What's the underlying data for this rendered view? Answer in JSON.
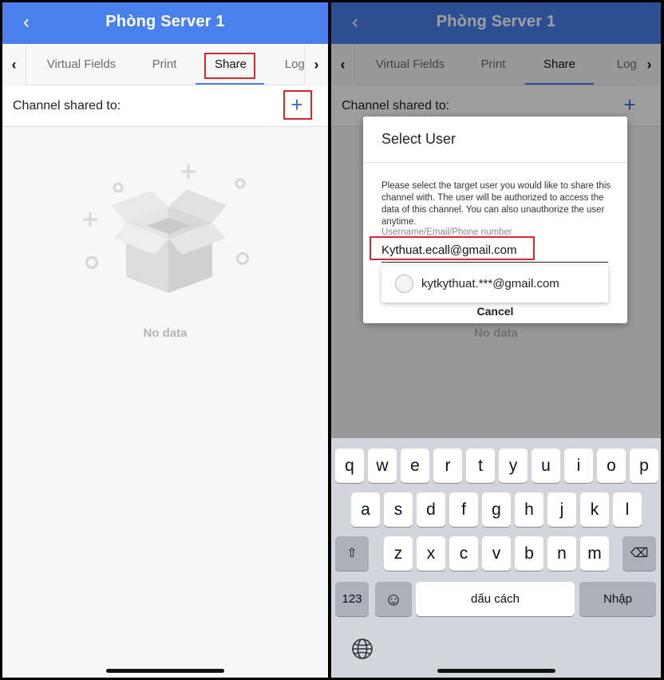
{
  "left": {
    "appbar": {
      "title": "Phòng Server 1",
      "back_glyph": "‹"
    },
    "tabs": [
      {
        "label": "Virtual Fields",
        "active": false
      },
      {
        "label": "Print",
        "active": false
      },
      {
        "label": "Share",
        "active": true
      },
      {
        "label": "Logs",
        "active": false
      }
    ],
    "channel_row": {
      "label": "Channel shared to:",
      "add_glyph": "+"
    },
    "empty_state": {
      "text": "No data"
    }
  },
  "right": {
    "appbar": {
      "title": "Phòng Server 1",
      "back_glyph": "‹"
    },
    "tabs": [
      {
        "label": "Virtual Fields",
        "active": false
      },
      {
        "label": "Print",
        "active": false
      },
      {
        "label": "Share",
        "active": true
      },
      {
        "label": "Logs",
        "active": false
      }
    ],
    "channel_row": {
      "label": "Channel shared to:",
      "add_glyph": "+"
    },
    "empty_state": {
      "text": "No data"
    },
    "dialog": {
      "title": "Select User",
      "message": "Please select the target user you would like to share this channel with. The user will be authorized to access the data of this channel. You can also unauthorize the user anytime.",
      "field_label": "Username/Email/Phone number",
      "input_value": "Kythuat.ecall@gmail.com",
      "suggestion": "kytkythuat.***@gmail.com",
      "cancel_label": "Cancel"
    },
    "keyboard": {
      "row1": [
        "q",
        "w",
        "e",
        "r",
        "t",
        "y",
        "u",
        "i",
        "o",
        "p"
      ],
      "row2": [
        "a",
        "s",
        "d",
        "f",
        "g",
        "h",
        "j",
        "k",
        "l"
      ],
      "row3": [
        "z",
        "x",
        "c",
        "v",
        "b",
        "n",
        "m"
      ],
      "shift_glyph": "⇧",
      "backspace_glyph": "⌫",
      "numbers_label": "123",
      "emoji_glyph": "☺",
      "space_label": "dấu cách",
      "return_label": "Nhập"
    }
  },
  "colors": {
    "appbar": "#4a80ec",
    "accent": "#3a6fd8",
    "highlight": "#d8282f"
  },
  "arrow_glyphs": {
    "left": "‹",
    "right": "›"
  }
}
